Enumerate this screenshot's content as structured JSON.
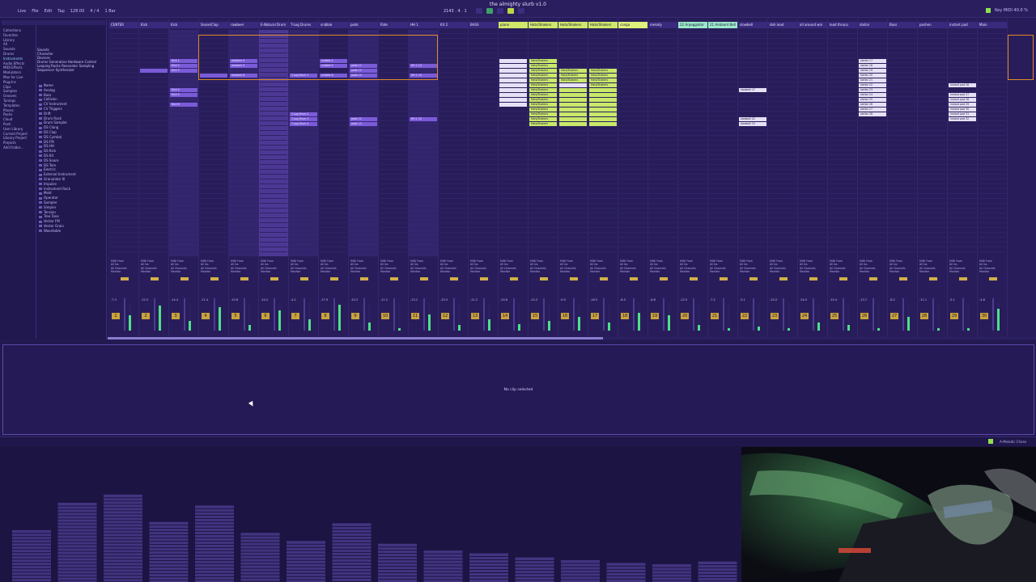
{
  "window": {
    "title": "the almighty slurb v1.0"
  },
  "transport": {
    "tempo": "128.00",
    "position": "2143 . 4 . 1",
    "menus": [
      "Live",
      "File",
      "Edit",
      "Tap",
      "128.00",
      "4 / 4",
      "1 Bar"
    ],
    "right_label": "Key  MIDI  40.0 %"
  },
  "browser": {
    "categories": [
      "Collections",
      "Favorites",
      "Library",
      "All",
      "Sounds",
      "Drums",
      "Instruments",
      "Audio Effects",
      "MIDI Effects",
      "Modulators",
      "Max for Live",
      "Plug-Ins",
      "Clips",
      "Samples",
      "Grooves",
      "Tunings",
      "Templates",
      "Places",
      "Packs",
      "Cloud",
      "Push",
      "User Library",
      "Current Project",
      "Library Project",
      "Projects",
      "Add Folder..."
    ],
    "tabs": [
      "Sounds",
      "Character",
      "Devices",
      "Drums  Generative  Hardware Control",
      "Looping  Racks  Resonator  Sampling",
      "Sequencer  Synthesizer"
    ],
    "items": [
      "Name",
      "Analog",
      "Bass",
      "Collision",
      "CV Instrument",
      "CV Triggers",
      "Drift",
      "Drum Rack",
      "Drum Sampler",
      "DS Clang",
      "DS Clap",
      "DS Cymbal",
      "DS FM",
      "DS HH",
      "DS Kick",
      "DS Kit",
      "DS Snare",
      "DS Tom",
      "Electric",
      "External Instrument",
      "Granulator III",
      "Impulse",
      "Instrument Rack",
      "Meld",
      "Operator",
      "Sampler",
      "Simpler",
      "Tension",
      "Tree Tone",
      "Vector FM",
      "Vector Grain",
      "Wavetable"
    ]
  },
  "tracks": [
    {
      "name": "CENTER",
      "hl": "",
      "clips": []
    },
    {
      "name": "Kick",
      "hl": "",
      "clips": [
        {
          "row": 8,
          "color": "purple",
          "label": ""
        }
      ]
    },
    {
      "name": "Kick",
      "hl": "",
      "clips": [
        {
          "row": 6,
          "color": "purple",
          "label": "Kick 1"
        },
        {
          "row": 7,
          "color": "purple",
          "label": "Kick 2"
        },
        {
          "row": 8,
          "color": "purple",
          "label": "Kick 3"
        },
        {
          "row": 12,
          "color": "purple",
          "label": "Kick 4"
        },
        {
          "row": 13,
          "color": "purple",
          "label": "Kick 5"
        },
        {
          "row": 15,
          "color": "purple",
          "label": "Kick 6"
        }
      ]
    },
    {
      "name": "Snare/Clap",
      "hl": "",
      "clips": [
        {
          "row": 9,
          "color": "purple",
          "label": ""
        }
      ]
    },
    {
      "name": "rawbeer",
      "hl": "",
      "clips": [
        {
          "row": 6,
          "color": "purple",
          "label": "rawbeer 4"
        },
        {
          "row": 7,
          "color": "purple",
          "label": "rawbeer 5"
        },
        {
          "row": 9,
          "color": "purple",
          "label": "rawbeer 6"
        }
      ]
    },
    {
      "name": "E-Natural Drum",
      "hl": "",
      "clips": []
    },
    {
      "name": "T-Log Drums",
      "hl": "",
      "clips": [
        {
          "row": 9,
          "color": "purple",
          "label": "T-Log Drum 1"
        },
        {
          "row": 17,
          "color": "purple",
          "label": "T-Log Drum 2"
        },
        {
          "row": 18,
          "color": "purple",
          "label": "T-Log Drum 3"
        },
        {
          "row": 19,
          "color": "purple",
          "label": "T-Log Drum 4"
        }
      ]
    },
    {
      "name": "snibble",
      "hl": "",
      "clips": [
        {
          "row": 6,
          "color": "purple",
          "label": "snibble 4"
        },
        {
          "row": 7,
          "color": "purple",
          "label": "snibble 5"
        },
        {
          "row": 9,
          "color": "purple",
          "label": "snibble 6"
        }
      ]
    },
    {
      "name": "pods",
      "hl": "",
      "clips": [
        {
          "row": 7,
          "color": "purple",
          "label": "pods 11"
        },
        {
          "row": 8,
          "color": "purple",
          "label": "pods 12"
        },
        {
          "row": 9,
          "color": "purple",
          "label": "pods 14"
        },
        {
          "row": 18,
          "color": "purple",
          "label": "pods 12"
        },
        {
          "row": 19,
          "color": "purple",
          "label": "pods 13"
        }
      ]
    },
    {
      "name": "Ride",
      "hl": "",
      "clips": []
    },
    {
      "name": "HH 1",
      "hl": "",
      "clips": [
        {
          "row": 7,
          "color": "purple",
          "label": "HH 1 13"
        },
        {
          "row": 9,
          "color": "purple",
          "label": "HH 1 14"
        },
        {
          "row": 18,
          "color": "purple",
          "label": "HH 1 15"
        }
      ]
    },
    {
      "name": "Kit 2",
      "hl": "",
      "clips": []
    },
    {
      "name": "BASS",
      "hl": "",
      "clips": []
    },
    {
      "name": "piano",
      "hl": "hl",
      "clips": [
        {
          "row": 6,
          "color": "white",
          "label": ""
        },
        {
          "row": 7,
          "color": "white",
          "label": ""
        },
        {
          "row": 8,
          "color": "white",
          "label": ""
        },
        {
          "row": 9,
          "color": "white",
          "label": ""
        },
        {
          "row": 10,
          "color": "white",
          "label": ""
        },
        {
          "row": 11,
          "color": "white",
          "label": ""
        },
        {
          "row": 12,
          "color": "white",
          "label": ""
        },
        {
          "row": 13,
          "color": "white",
          "label": ""
        },
        {
          "row": 14,
          "color": "white",
          "label": ""
        },
        {
          "row": 15,
          "color": "white",
          "label": ""
        }
      ]
    },
    {
      "name": "Hats/Shakers",
      "hl": "hl",
      "clips": [
        {
          "row": 6,
          "color": "lime",
          "label": "Hats/Shakers"
        },
        {
          "row": 7,
          "color": "lime",
          "label": "Hats/Shakers"
        },
        {
          "row": 8,
          "color": "lime",
          "label": "Hats/Shakers"
        },
        {
          "row": 9,
          "color": "lime",
          "label": "Hats/Shakers"
        },
        {
          "row": 10,
          "color": "lime",
          "label": "Hats/Shakers"
        },
        {
          "row": 11,
          "color": "lime",
          "label": "Hats/Shakers"
        },
        {
          "row": 12,
          "color": "lime",
          "label": "Hats/Shakers"
        },
        {
          "row": 13,
          "color": "lime",
          "label": "Hats/Shakers"
        },
        {
          "row": 14,
          "color": "lime",
          "label": "Hats/Shakers"
        },
        {
          "row": 15,
          "color": "lime",
          "label": "Hats/Shakers"
        },
        {
          "row": 16,
          "color": "lime",
          "label": "Hats/Shakers"
        },
        {
          "row": 17,
          "color": "lime",
          "label": "Hats/Shakers"
        },
        {
          "row": 18,
          "color": "lime",
          "label": "Hats/Shakers"
        },
        {
          "row": 19,
          "color": "lime",
          "label": "Hats/Shakers"
        }
      ]
    },
    {
      "name": "Hats/Shakers",
      "hl": "hl",
      "clips": [
        {
          "row": 8,
          "color": "lime",
          "label": "Hats/Shakers"
        },
        {
          "row": 9,
          "color": "lime",
          "label": "Hats/Shakers"
        },
        {
          "row": 10,
          "color": "lime",
          "label": "Hats/Shakers"
        },
        {
          "row": 11,
          "color": "white",
          "label": ""
        },
        {
          "row": 12,
          "color": "lime",
          "label": ""
        },
        {
          "row": 13,
          "color": "lime",
          "label": ""
        },
        {
          "row": 14,
          "color": "lime",
          "label": ""
        },
        {
          "row": 15,
          "color": "lime",
          "label": ""
        },
        {
          "row": 16,
          "color": "lime",
          "label": ""
        },
        {
          "row": 17,
          "color": "lime",
          "label": ""
        },
        {
          "row": 18,
          "color": "lime",
          "label": ""
        },
        {
          "row": 19,
          "color": "lime",
          "label": ""
        }
      ]
    },
    {
      "name": "Hats/Shakers",
      "hl": "hl",
      "clips": [
        {
          "row": 8,
          "color": "lime",
          "label": "Hats/Shakers"
        },
        {
          "row": 9,
          "color": "lime",
          "label": "Hats/Shakers"
        },
        {
          "row": 10,
          "color": "lime",
          "label": "Hats/Shakers"
        },
        {
          "row": 11,
          "color": "lime",
          "label": "Hats/Shakers"
        },
        {
          "row": 12,
          "color": "lime",
          "label": ""
        },
        {
          "row": 13,
          "color": "lime",
          "label": ""
        },
        {
          "row": 14,
          "color": "lime",
          "label": ""
        },
        {
          "row": 15,
          "color": "lime",
          "label": ""
        },
        {
          "row": 16,
          "color": "lime",
          "label": ""
        },
        {
          "row": 17,
          "color": "lime",
          "label": ""
        },
        {
          "row": 18,
          "color": "lime",
          "label": ""
        },
        {
          "row": 19,
          "color": "lime",
          "label": ""
        }
      ]
    },
    {
      "name": "conga",
      "hl": "hl3",
      "clips": []
    },
    {
      "name": "melody",
      "hl": "",
      "clips": []
    },
    {
      "name": "22 Arpeggiator",
      "hl": "hl2",
      "clips": []
    },
    {
      "name": "21 Ambient Bell",
      "hl": "hl2",
      "clips": []
    },
    {
      "name": "slowbell",
      "hl": "",
      "clips": [
        {
          "row": 12,
          "color": "white",
          "label": "slowbell 17"
        },
        {
          "row": 18,
          "color": "white",
          "label": "slowbell 22"
        },
        {
          "row": 19,
          "color": "white",
          "label": "slowbell 23"
        }
      ]
    },
    {
      "name": "doh lead",
      "hl": "",
      "clips": []
    },
    {
      "name": "all around win",
      "hl": "",
      "clips": []
    },
    {
      "name": "lead thruco",
      "hl": "",
      "clips": []
    },
    {
      "name": "stellar",
      "hl": "",
      "clips": [
        {
          "row": 6,
          "color": "white",
          "label": "stellar 17"
        },
        {
          "row": 7,
          "color": "white",
          "label": "stellar 18"
        },
        {
          "row": 8,
          "color": "white",
          "label": "stellar 19"
        },
        {
          "row": 9,
          "color": "white",
          "label": "stellar 20"
        },
        {
          "row": 10,
          "color": "white",
          "label": "stellar 21"
        },
        {
          "row": 11,
          "color": "white",
          "label": "stellar 22"
        },
        {
          "row": 12,
          "color": "white",
          "label": "stellar 23"
        },
        {
          "row": 13,
          "color": "white",
          "label": "stellar 24"
        },
        {
          "row": 14,
          "color": "white",
          "label": "stellar 25"
        },
        {
          "row": 15,
          "color": "white",
          "label": "stellar 26"
        },
        {
          "row": 16,
          "color": "white",
          "label": "stellar 27"
        },
        {
          "row": 17,
          "color": "white",
          "label": "stellar 28"
        }
      ]
    },
    {
      "name": "Bass",
      "hl": "",
      "clips": []
    },
    {
      "name": "poshen",
      "hl": "",
      "clips": []
    },
    {
      "name": "instant pad",
      "hl": "",
      "clips": [
        {
          "row": 11,
          "color": "white",
          "label": "instant pad 26"
        },
        {
          "row": 13,
          "color": "white",
          "label": "instant pad 27"
        },
        {
          "row": 14,
          "color": "white",
          "label": "instant pad 28"
        },
        {
          "row": 15,
          "color": "white",
          "label": "instant pad 29"
        },
        {
          "row": 16,
          "color": "white",
          "label": "instant pad 30"
        },
        {
          "row": 17,
          "color": "white",
          "label": "instant pad 31"
        },
        {
          "row": 18,
          "color": "white",
          "label": "instant pad 32"
        }
      ]
    },
    {
      "name": "Main",
      "hl": "",
      "clips": []
    }
  ],
  "mixer": {
    "io_labels": [
      "MIDI From",
      "All Ins",
      "All Channels",
      "Monitor",
      "In  Auto  Off",
      "Audio To",
      "Main"
    ],
    "track_numbers": [
      "1",
      "2",
      "3",
      "4",
      "5",
      "6",
      "7",
      "8",
      "9",
      "10",
      "11",
      "12",
      "13",
      "14",
      "15",
      "16",
      "17",
      "18",
      "19",
      "20",
      "21",
      "22",
      "23",
      "24",
      "25",
      "26",
      "27",
      "28",
      "29",
      "30"
    ],
    "db_values": [
      "-7.3",
      "-12.5",
      "-14.4",
      "-11.4",
      "-15.6",
      "-14.2",
      "-4.1",
      "-17.9",
      "-10.2",
      "-11.2",
      "-13.1",
      "-10.5",
      "-11.2",
      "-24.6",
      "-10.3",
      "-9.9",
      "-16.5",
      "-8.0",
      "-8.8",
      "-12.0",
      "-7.2",
      "-5.1",
      "-15.0",
      "-24.0",
      "-10.4",
      "-13.7",
      "-8.2",
      "-11.1",
      "-5.1",
      "-4.8"
    ],
    "meter_levels": [
      0.55,
      0.9,
      0.35,
      0.85,
      0.2,
      0.75,
      0.4,
      0.95,
      0.3,
      0.1,
      0.6,
      0.2,
      0.4,
      0.25,
      0.35,
      0.5,
      0.3,
      0.65,
      0.55,
      0.2,
      0.1,
      0.15,
      0.1,
      0.3,
      0.2,
      0.1,
      0.5,
      0.1,
      0.1,
      0.8
    ]
  },
  "detail": {
    "message": "No clip selected"
  },
  "statusbar": {
    "right": "A-Melodic Chose"
  },
  "spectrum": {
    "bar_levels": [
      0.38,
      0.58,
      0.64,
      0.44,
      0.56,
      0.36,
      0.3,
      0.43,
      0.28,
      0.23,
      0.21,
      0.18,
      0.16,
      0.14,
      0.13,
      0.15
    ]
  }
}
